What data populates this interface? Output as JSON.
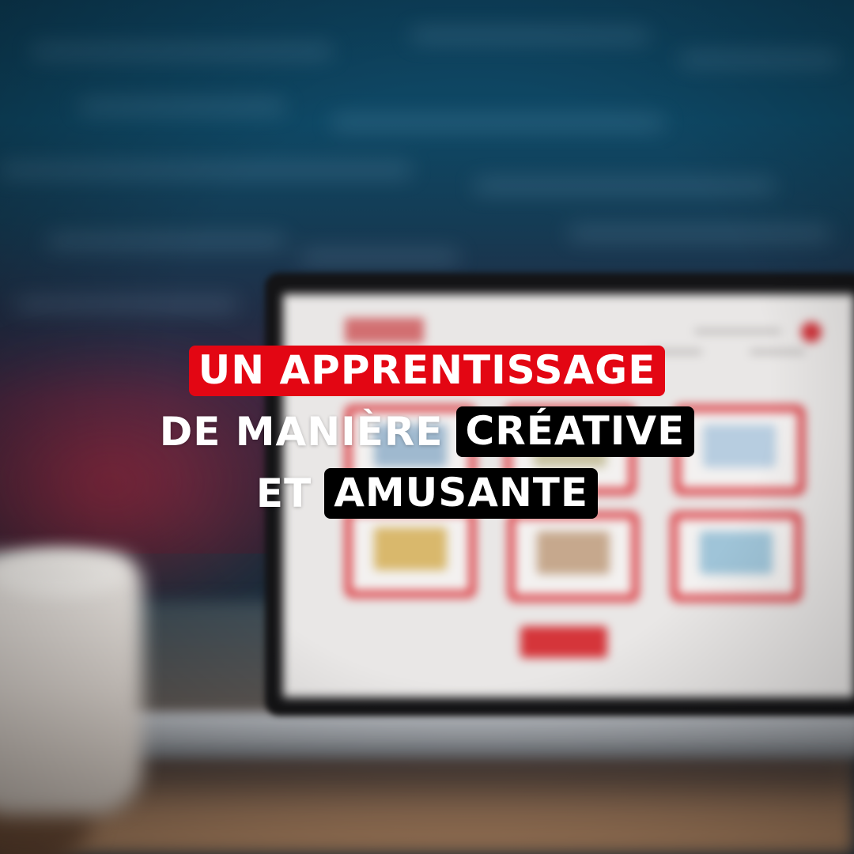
{
  "headline": {
    "line1": "UN APPRENTISSAGE",
    "line2_plain": "DE MANIÈRE",
    "line2_highlight": "CRÉATIVE",
    "line3_plain": "ET",
    "line3_highlight": "AMUSANTE"
  },
  "colors": {
    "accent_red": "#e30613",
    "highlight_black": "#000000",
    "text_white": "#ffffff"
  }
}
